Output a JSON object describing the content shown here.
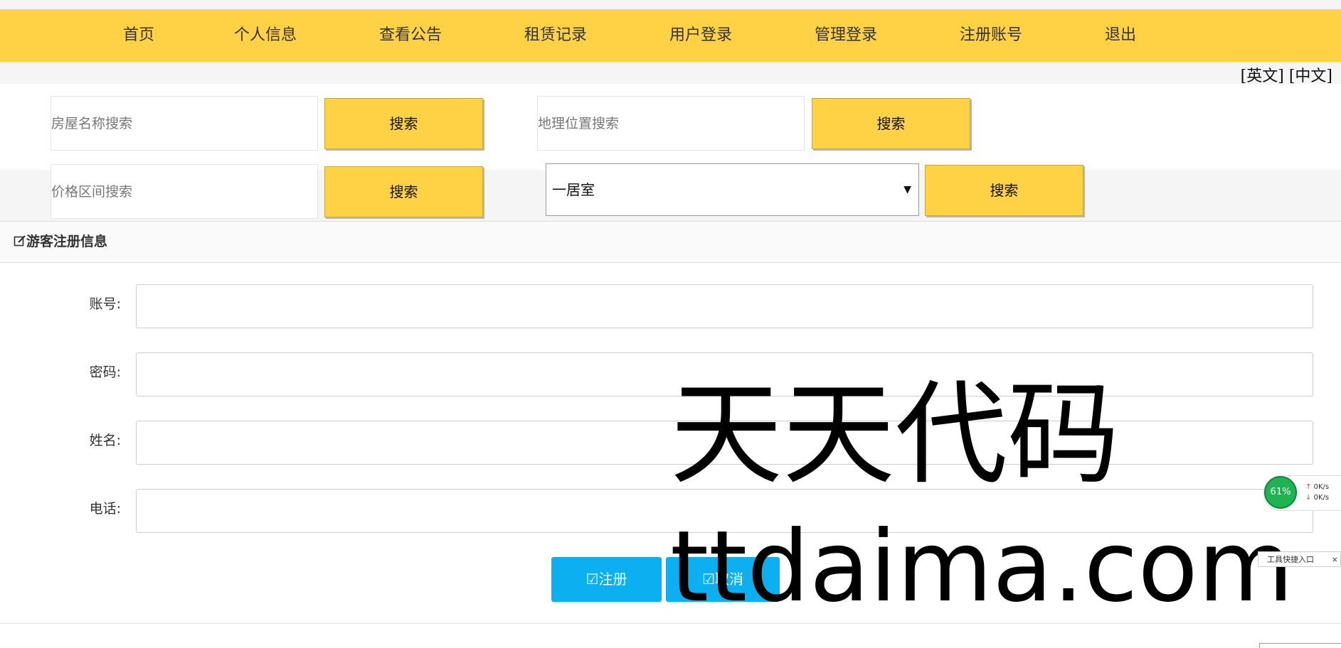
{
  "nav": {
    "items": [
      "首页",
      "个人信息",
      "查看公告",
      "租赁记录",
      "用户登录",
      "管理登录",
      "注册账号",
      "退出"
    ]
  },
  "lang": {
    "en": "[英文]",
    "zh": "[中文]"
  },
  "search": {
    "name_placeholder": "房屋名称搜索",
    "location_placeholder": "地理位置搜索",
    "price_placeholder": "价格区间搜索",
    "button_label": "搜索",
    "room_type_selected": "一居室"
  },
  "panel": {
    "title": "游客注册信息"
  },
  "form": {
    "account_label": "账号:",
    "password_label": "密码:",
    "name_label": "姓名:",
    "phone_label": "电话:",
    "register_label": "注册",
    "cancel_label": "取消"
  },
  "watermark": {
    "line1": "天天代码",
    "line2": "ttdaima.com"
  },
  "widget": {
    "percent": "61%",
    "up_speed": "0K/s",
    "down_speed": "0K/s",
    "tooltip": "工具快捷入口"
  },
  "colors": {
    "nav_bg": "#ffd246",
    "button_bg": "#ffd246",
    "action_bg": "#0cb0f0"
  }
}
